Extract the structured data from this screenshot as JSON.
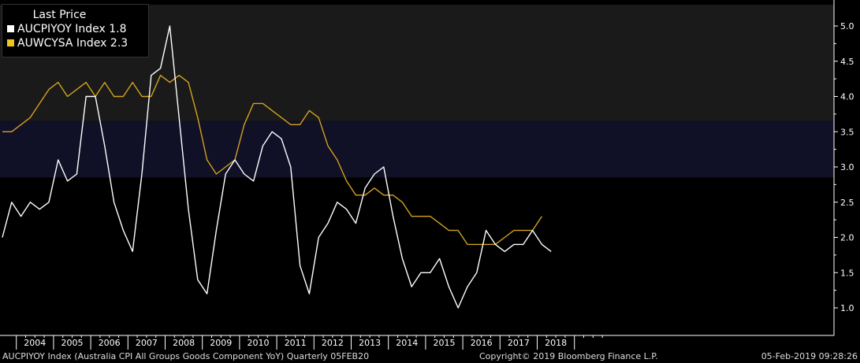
{
  "legend": {
    "title": "Last Price",
    "items": [
      {
        "label": "AUCPIYOY Index",
        "value": "1.8",
        "color": "#ffffff"
      },
      {
        "label": "AUWCYSA Index",
        "value": "2.3",
        "color": "#f0c419"
      }
    ]
  },
  "footer": {
    "left": "AUCPIYOY Index (Australia CPI All Groups Goods Component YoY)  Quarterly 05FEB20",
    "center": "Copyright© 2019 Bloomberg Finance L.P.",
    "right": "05-Feb-2019 09:28:26"
  },
  "colors": {
    "background": "#000000",
    "band_upper": "#1a1a1a",
    "band_target": "#101026",
    "axis": "#ffffff",
    "series1": "#ffffff",
    "series2": "#d4a21c"
  },
  "chart_data": {
    "type": "line",
    "title": "",
    "xlabel": "",
    "ylabel": "",
    "x_ticks": [
      "2004",
      "2005",
      "2006",
      "2007",
      "2008",
      "2009",
      "2010",
      "2011",
      "2012",
      "2013",
      "2014",
      "2015",
      "2016",
      "2017",
      "2018"
    ],
    "y_ticks": [
      "1.0",
      "1.5",
      "2.0",
      "2.5",
      "3.0",
      "3.5",
      "4.0",
      "4.5",
      "5.0"
    ],
    "ylim": [
      0.7,
      5.3
    ],
    "x_range": [
      "2003 Q3",
      "2018 Q4"
    ],
    "grid": false,
    "legend_position": "top-left",
    "bands": [
      {
        "from": 3.65,
        "to": 5.3,
        "color": "upper"
      },
      {
        "from": 2.85,
        "to": 3.65,
        "color": "target"
      }
    ],
    "x": [
      "2003 Q3",
      "2003 Q4",
      "2004 Q1",
      "2004 Q2",
      "2004 Q3",
      "2004 Q4",
      "2005 Q1",
      "2005 Q2",
      "2005 Q3",
      "2005 Q4",
      "2006 Q1",
      "2006 Q2",
      "2006 Q3",
      "2006 Q4",
      "2007 Q1",
      "2007 Q2",
      "2007 Q3",
      "2007 Q4",
      "2008 Q1",
      "2008 Q2",
      "2008 Q3",
      "2008 Q4",
      "2009 Q1",
      "2009 Q2",
      "2009 Q3",
      "2009 Q4",
      "2010 Q1",
      "2010 Q2",
      "2010 Q3",
      "2010 Q4",
      "2011 Q1",
      "2011 Q2",
      "2011 Q3",
      "2011 Q4",
      "2012 Q1",
      "2012 Q2",
      "2012 Q3",
      "2012 Q4",
      "2013 Q1",
      "2013 Q2",
      "2013 Q3",
      "2013 Q4",
      "2014 Q1",
      "2014 Q2",
      "2014 Q3",
      "2014 Q4",
      "2015 Q1",
      "2015 Q2",
      "2015 Q3",
      "2015 Q4",
      "2016 Q1",
      "2016 Q2",
      "2016 Q3",
      "2016 Q4",
      "2017 Q1",
      "2017 Q2",
      "2017 Q3",
      "2017 Q4",
      "2018 Q1",
      "2018 Q2",
      "2018 Q3",
      "2018 Q4"
    ],
    "series": [
      {
        "name": "AUCPIYOY Index",
        "color": "#ffffff",
        "values": [
          2.0,
          2.5,
          2.3,
          2.5,
          2.4,
          2.5,
          3.1,
          2.8,
          2.9,
          4.0,
          4.0,
          3.3,
          2.5,
          2.1,
          1.8,
          2.9,
          4.3,
          4.4,
          5.0,
          3.7,
          2.4,
          1.4,
          1.2,
          2.1,
          2.9,
          3.1,
          2.9,
          2.8,
          3.3,
          3.5,
          3.4,
          3.0,
          1.6,
          1.2,
          2.0,
          2.2,
          2.5,
          2.4,
          2.2,
          2.7,
          2.9,
          3.0,
          2.3,
          1.7,
          1.3,
          1.5,
          1.5,
          1.7,
          1.3,
          1.0,
          1.3,
          1.5,
          2.1,
          1.9,
          1.8,
          1.9,
          1.9,
          2.1,
          1.9,
          1.8,
          null,
          null
        ]
      },
      {
        "name": "AUWCYSA Index",
        "color": "#d4a21c",
        "values": [
          3.5,
          3.5,
          3.6,
          3.7,
          3.9,
          4.1,
          4.2,
          4.0,
          4.1,
          4.2,
          4.0,
          4.2,
          4.0,
          4.0,
          4.2,
          4.0,
          4.0,
          4.3,
          4.2,
          4.3,
          4.2,
          3.7,
          3.1,
          2.9,
          3.0,
          3.1,
          3.6,
          3.9,
          3.9,
          3.8,
          3.7,
          3.6,
          3.6,
          3.8,
          3.7,
          3.3,
          3.1,
          2.8,
          2.6,
          2.6,
          2.7,
          2.6,
          2.6,
          2.5,
          2.3,
          2.3,
          2.3,
          2.2,
          2.1,
          2.1,
          1.9,
          1.9,
          1.9,
          1.9,
          2.0,
          2.1,
          2.1,
          2.1,
          2.3,
          null,
          null,
          null
        ]
      }
    ]
  }
}
